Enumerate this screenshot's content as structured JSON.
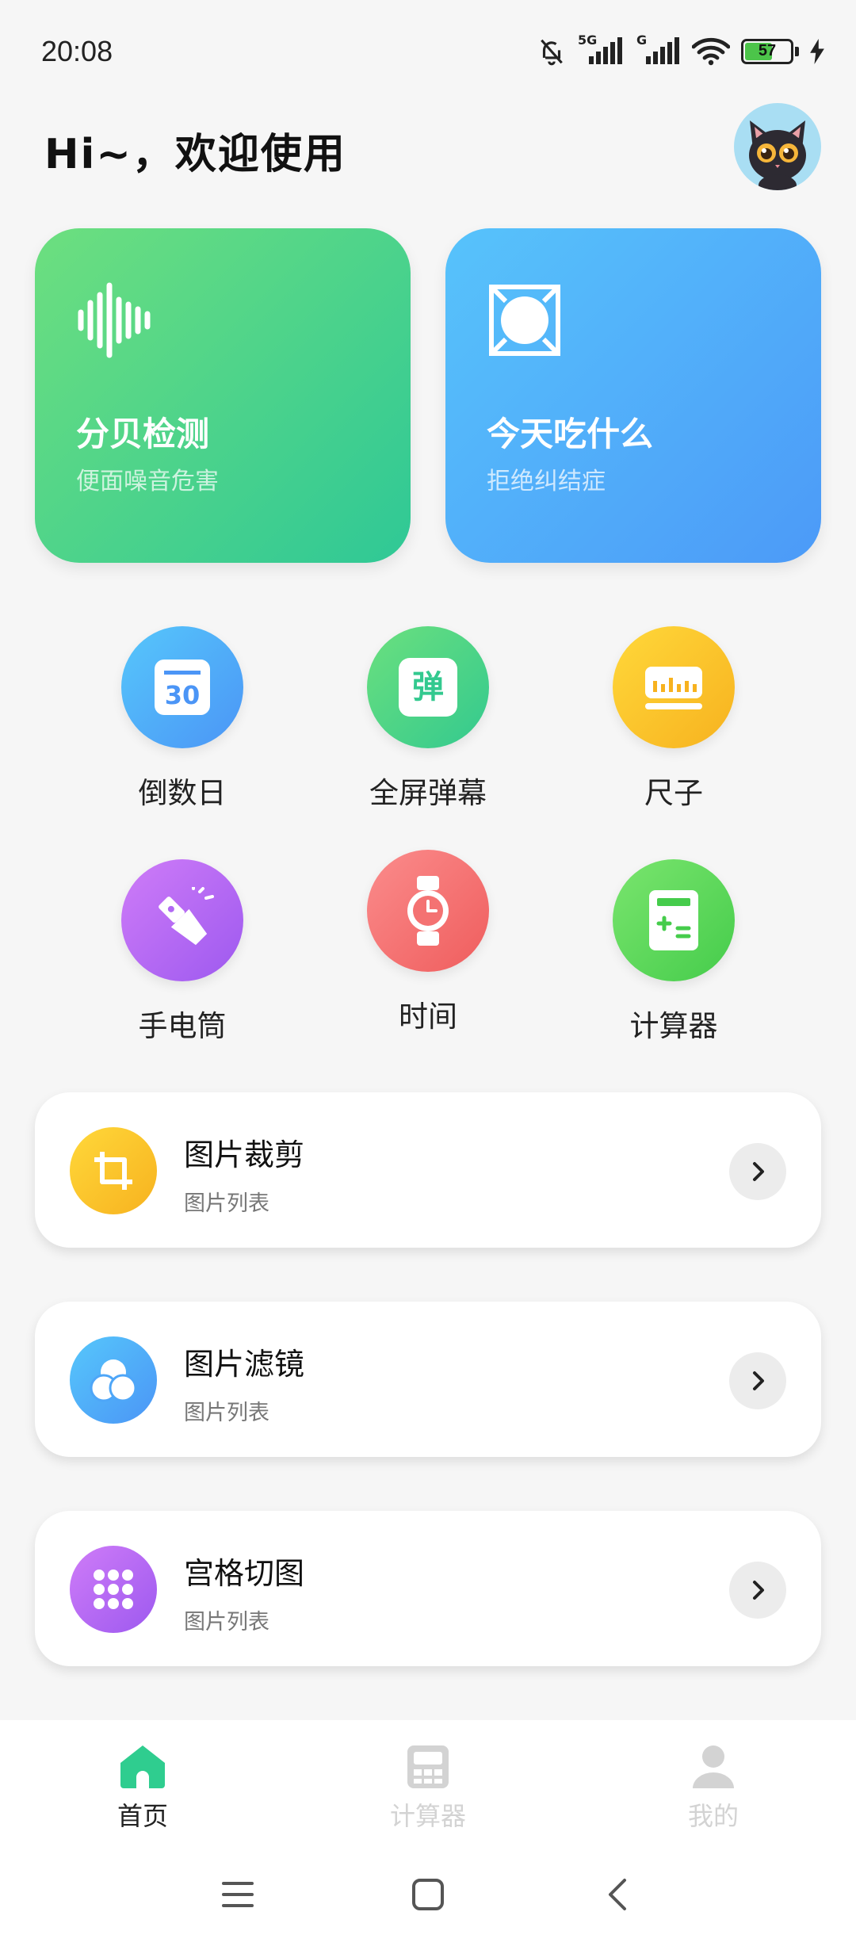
{
  "status": {
    "time": "20:08",
    "battery": "57",
    "signal1_label": "5G",
    "signal2_label": "G"
  },
  "header": {
    "greeting": "Hi~，欢迎使用"
  },
  "feature_cards": [
    {
      "title": "分贝检测",
      "subtitle": "便面噪音危害",
      "icon": "sound-wave-icon"
    },
    {
      "title": "今天吃什么",
      "subtitle": "拒绝纠结症",
      "icon": "plate-icon"
    }
  ],
  "grid": [
    {
      "label": "倒数日",
      "icon": "calendar-30-icon"
    },
    {
      "label": "全屏弹幕",
      "icon": "danmaku-icon",
      "icon_text": "弹"
    },
    {
      "label": "尺子",
      "icon": "ruler-icon"
    },
    {
      "label": "手电筒",
      "icon": "flashlight-icon"
    },
    {
      "label": "时间",
      "icon": "watch-icon"
    },
    {
      "label": "计算器",
      "icon": "calculator-icon"
    }
  ],
  "list_cards": [
    {
      "title": "图片裁剪",
      "subtitle": "图片列表",
      "icon": "crop-icon"
    },
    {
      "title": "图片滤镜",
      "subtitle": "图片列表",
      "icon": "filter-icon"
    },
    {
      "title": "宫格切图",
      "subtitle": "图片列表",
      "icon": "grid-dots-icon"
    }
  ],
  "bottom_nav": [
    {
      "label": "首页",
      "icon": "home-icon",
      "active": true
    },
    {
      "label": "计算器",
      "icon": "calculator-nav-icon",
      "active": false
    },
    {
      "label": "我的",
      "icon": "user-icon",
      "active": false
    }
  ],
  "colors": {
    "active_nav": "#2fcd8f",
    "inactive_nav": "#d3d3d3"
  }
}
